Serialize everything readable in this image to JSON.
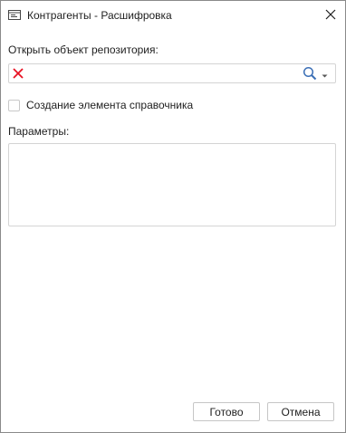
{
  "dialog": {
    "title": "Контрагенты - Расшифровка",
    "icons": {
      "title": "window-icon",
      "close": "close-icon"
    }
  },
  "repository": {
    "label": "Открыть объект репозитория:",
    "value": "",
    "icons": {
      "clear": "clear-x-icon",
      "search": "search-icon",
      "dropdown": "dropdown-arrow-icon"
    },
    "clear_icon_color": "#e81123",
    "search_icon_color": "#3b6fb6"
  },
  "create_item": {
    "label": "Создание элемента справочника",
    "checked": false
  },
  "parameters": {
    "label": "Параметры:"
  },
  "buttons": {
    "ok": "Готово",
    "cancel": "Отмена"
  }
}
